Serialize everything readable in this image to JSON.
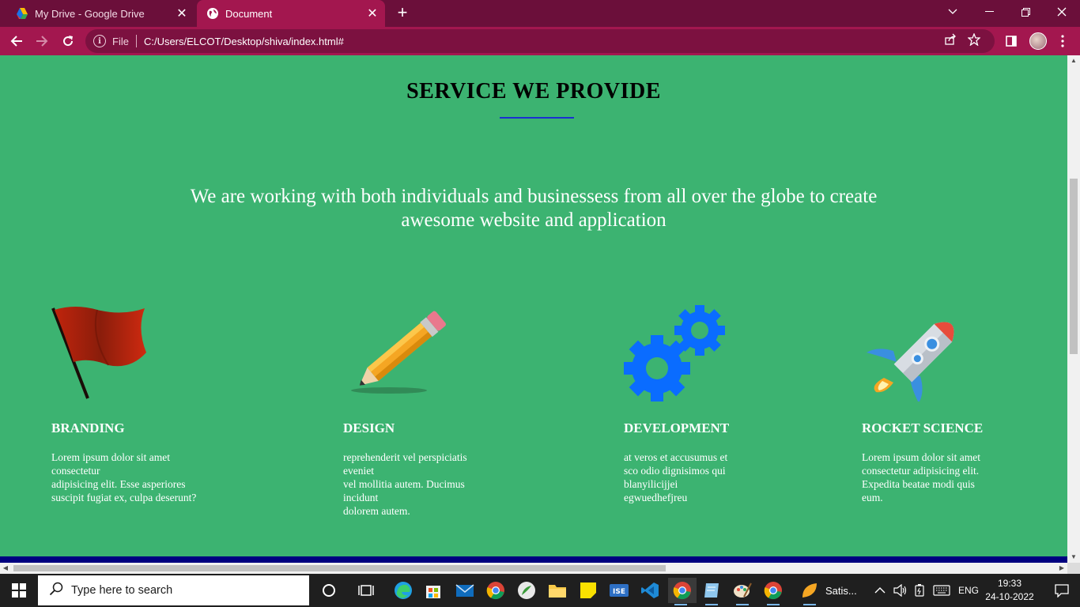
{
  "browser": {
    "tabs": [
      {
        "label": "My Drive - Google Drive",
        "active": false,
        "icon": "google-drive-icon"
      },
      {
        "label": "Document",
        "active": true,
        "icon": "globe-icon"
      }
    ],
    "address": {
      "scheme_label": "File",
      "url": "C:/Users/ELCOT/Desktop/shiva/index.html#"
    }
  },
  "page": {
    "title": "SERVICE WE PROVIDE",
    "intro": "We are working with both individuals and businessess from all over the globe to create awesome website and application",
    "services": [
      {
        "icon": "flag-icon",
        "title": "BRANDING",
        "text": "Lorem ipsum dolor sit amet\nconsectetur\nadipisicing elit. Esse asperiores\nsuscipit fugiat ex, culpa deserunt?"
      },
      {
        "icon": "pencil-icon",
        "title": "DESIGN",
        "text": "reprehenderit vel perspiciatis\neveniet\nvel mollitia autem. Ducimus\nincidunt\ndolorem autem."
      },
      {
        "icon": "gears-icon",
        "title": "DEVELOPMENT",
        "text": "at veros et accusumus et\nsco odio dignisimos qui\nblanyilicijjei\negwuedhefjreu"
      },
      {
        "icon": "rocket-icon",
        "title": "ROCKET SCIENCE",
        "text": "Lorem ipsum dolor sit amet\nconsectetur adipisicing elit.\nExpedita beatae modi quis\neum."
      }
    ],
    "colors": {
      "background": "#3cb371",
      "underline": "#1a2fd0",
      "footer_bar": "#000080"
    }
  },
  "taskbar": {
    "search_placeholder": "Type here to search",
    "app_label": "Satis...",
    "language": "ENG",
    "time": "19:33",
    "date": "24-10-2022"
  }
}
